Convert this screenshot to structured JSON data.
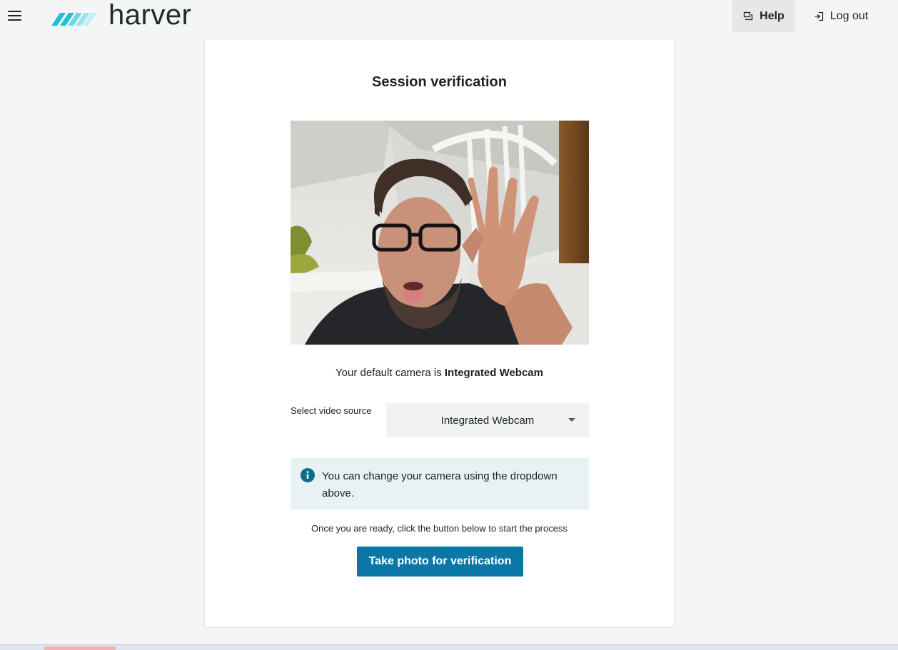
{
  "header": {
    "brand": "harver",
    "help_label": "Help",
    "logout_label": "Log out",
    "brand_colors": {
      "dark": "#1ec0d8",
      "mid": "#6fd6e6",
      "light": "#b9ecf3"
    }
  },
  "verification": {
    "title": "Session verification",
    "default_camera_prefix": "Your default camera is ",
    "default_camera_name": "Integrated Webcam",
    "video_source_label": "Select video source",
    "video_source_selected": "Integrated Webcam",
    "info_message": "You can change your camera using the dropdown above.",
    "ready_message": "Once you are ready, click the button below to start the process",
    "take_photo_label": "Take photo for verification"
  },
  "colors": {
    "primary_button": "#0b77a6",
    "info_background": "#e8f1f3",
    "info_icon": "#0d6e86",
    "page_background": "#f4f6f5"
  }
}
